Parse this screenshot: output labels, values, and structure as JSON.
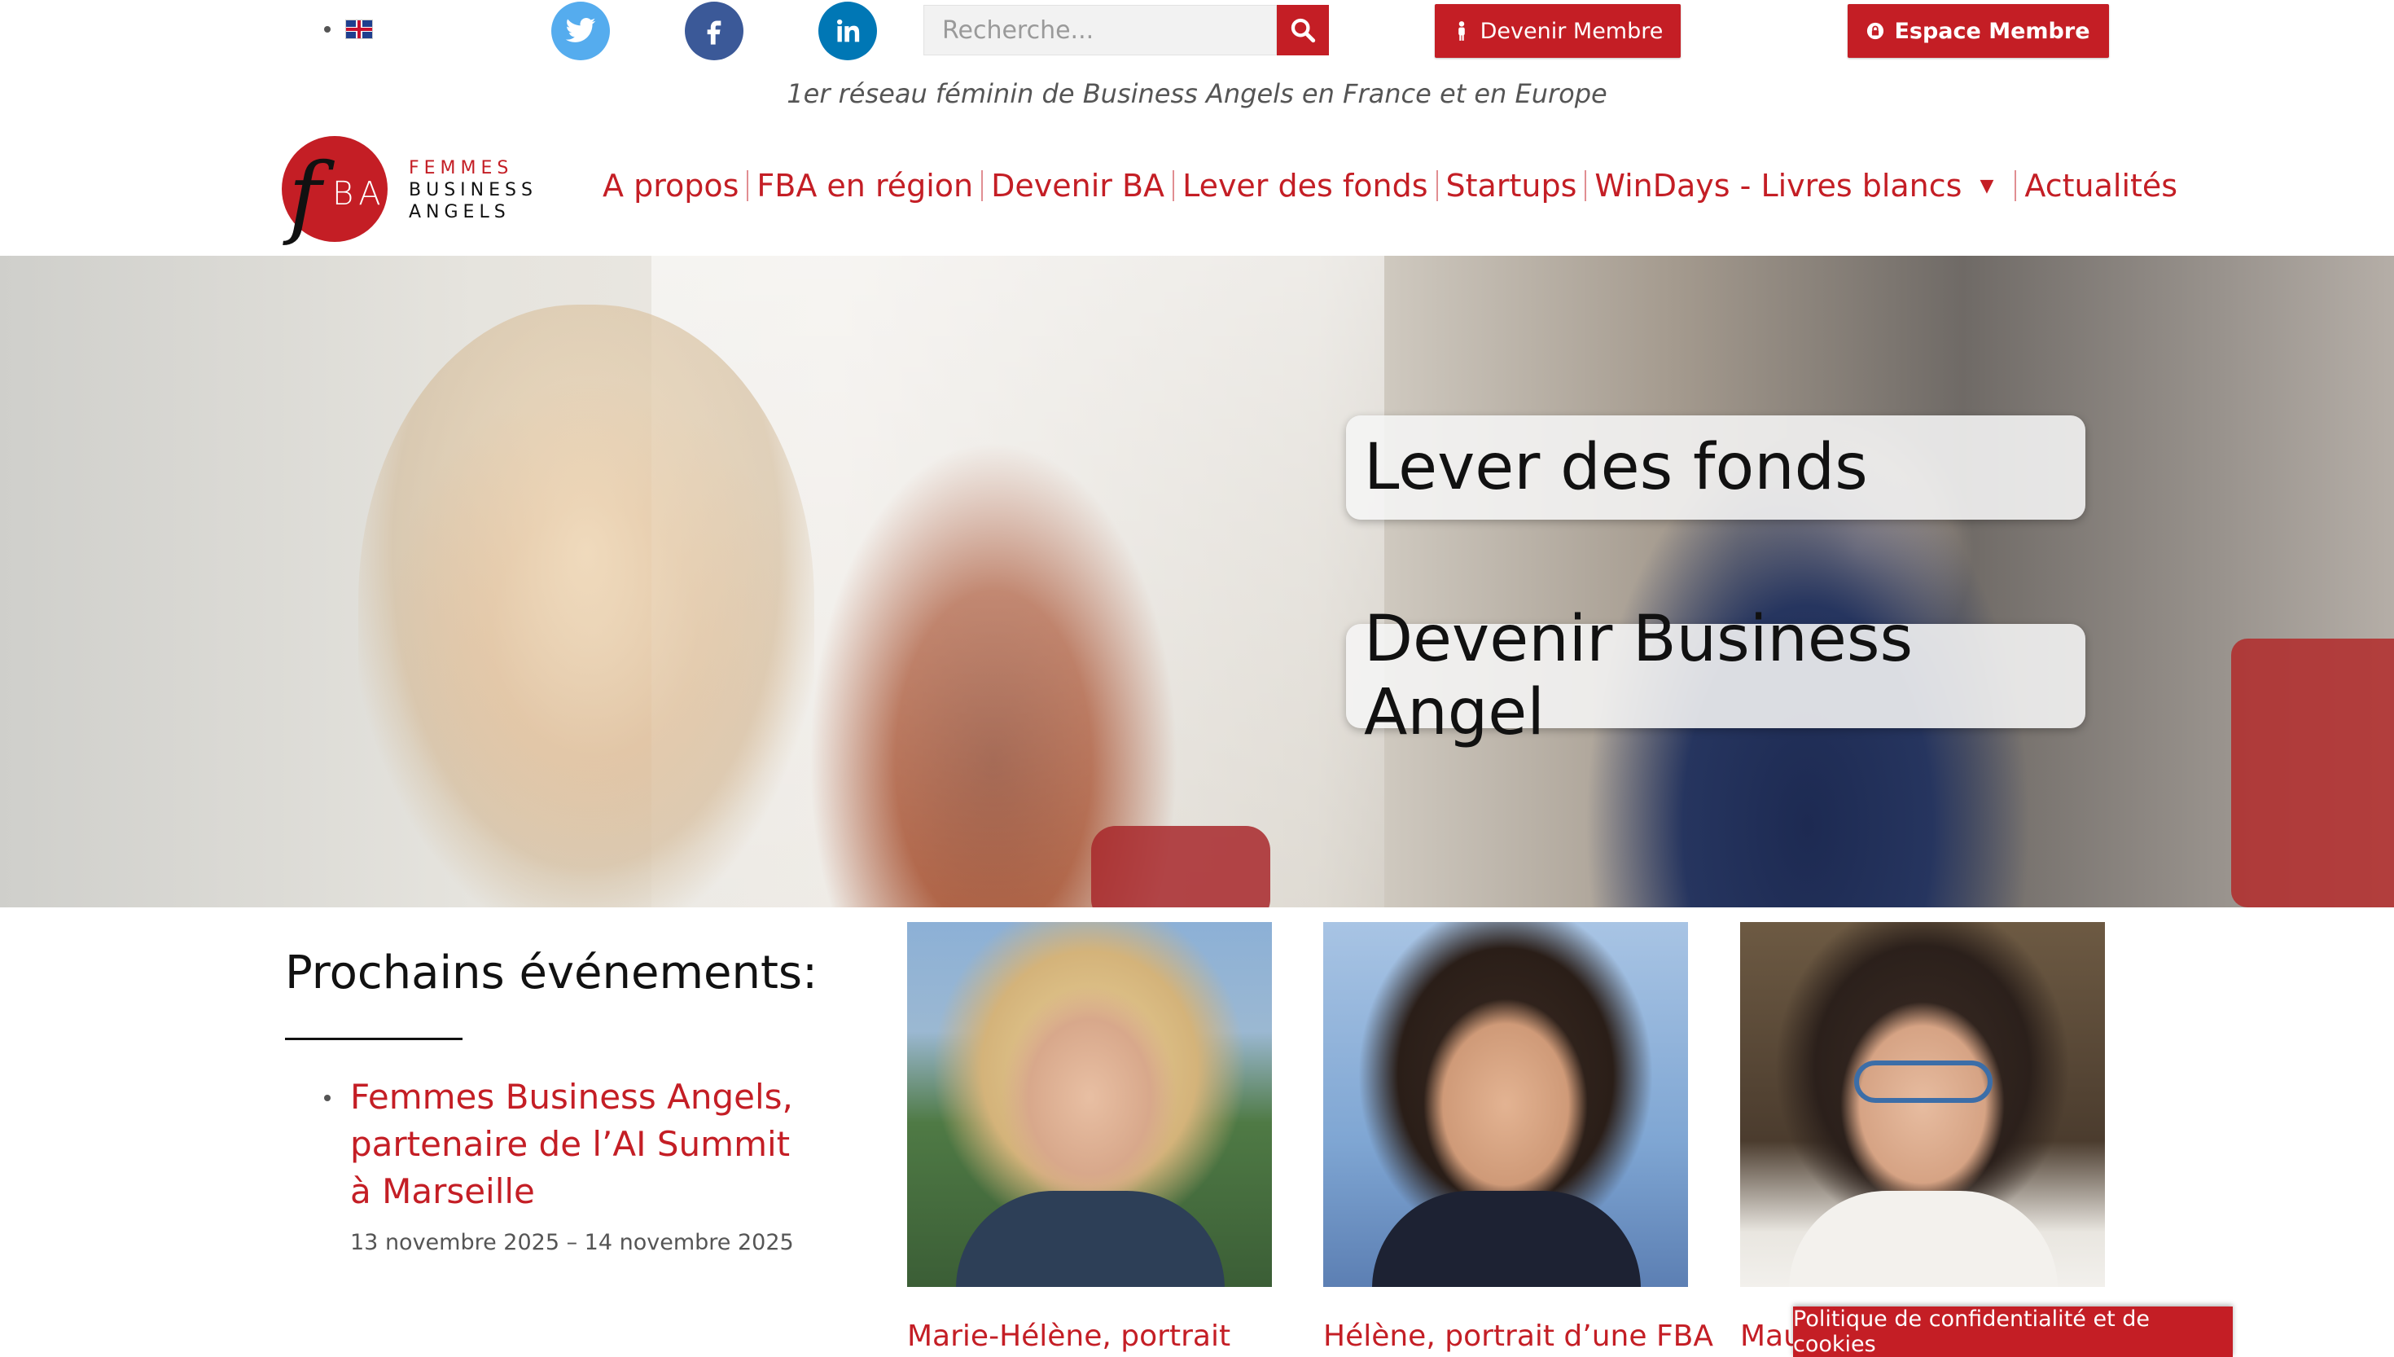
{
  "topbar": {
    "language": {
      "flag_icon": "uk-flag-icon"
    },
    "social": [
      {
        "name": "twitter",
        "icon": "twitter-icon",
        "color": "#55acee"
      },
      {
        "name": "facebook",
        "icon": "facebook-icon",
        "color": "#3b5998"
      },
      {
        "name": "linkedin",
        "icon": "linkedin-icon",
        "color": "#0077b5"
      }
    ],
    "search": {
      "placeholder": "Recherche...",
      "value": "",
      "button_icon": "search-icon"
    },
    "buttons": {
      "devenir_membre": "Devenir Membre",
      "espace_membre": "Espace Membre"
    }
  },
  "tagline": "1er réseau féminin de Business Angels en France et en Europe",
  "logo": {
    "monogram_f": "f",
    "monogram_ba": "BA",
    "line1": "FEMMES",
    "line2": "BUSINESS",
    "line3": "ANGELS"
  },
  "nav": {
    "items": [
      "A propos",
      "FBA en région",
      "Devenir BA",
      "Lever des fonds",
      "Startups",
      "WinDays - Livres blancs",
      "Actualités"
    ],
    "dropdown_caret": "▼"
  },
  "hero": {
    "cards": [
      "Lever des fonds",
      "Devenir Business Angel"
    ]
  },
  "events": {
    "title": "Prochains événements:",
    "items": [
      {
        "title": "Femmes Business Angels, partenaire de l’AI Summit à Marseille",
        "date": "13 novembre 2025 – 14 novembre 2025"
      }
    ]
  },
  "portraits": [
    {
      "caption": "Marie-Hélène, portrait"
    },
    {
      "caption": "Hélène, portrait d’une FBA"
    },
    {
      "caption": "Mau"
    }
  ],
  "cookie_bar": "Politique de confidentialité et de cookies",
  "colors": {
    "brand_red": "#c41e25",
    "text_dark": "#111111",
    "muted": "#555555"
  }
}
